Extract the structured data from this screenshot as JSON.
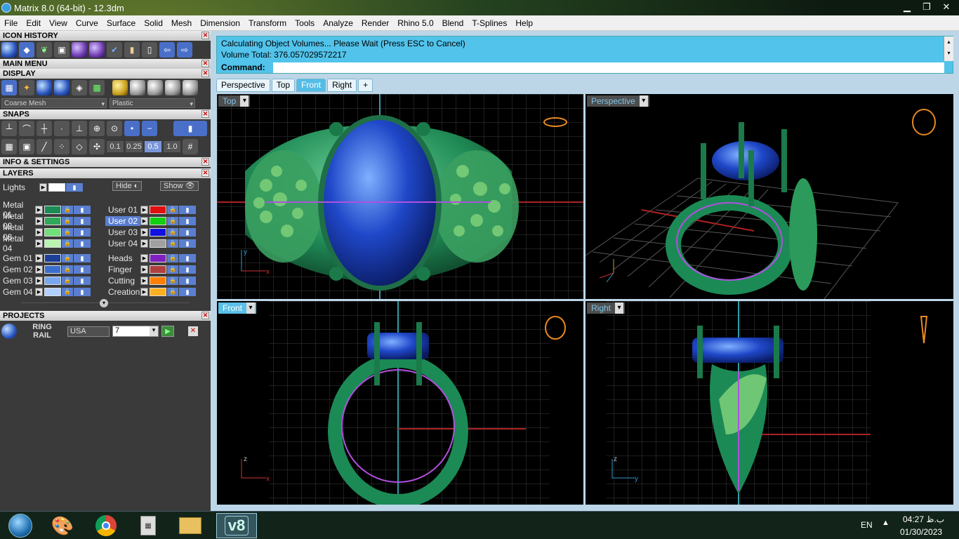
{
  "window": {
    "title": "Matrix 8.0 (64-bit) - 12.3dm",
    "buttons": {
      "minimize": "▁",
      "restore": "❐",
      "close": "✕"
    }
  },
  "menu": [
    "File",
    "Edit",
    "View",
    "Curve",
    "Surface",
    "Solid",
    "Mesh",
    "Dimension",
    "Transform",
    "Tools",
    "Analyze",
    "Render",
    "Rhino 5.0",
    "Blend",
    "T-Splines",
    "Help"
  ],
  "panel": {
    "icon_history": "ICON HISTORY",
    "main_menu": "MAIN MENU",
    "display": "DISPLAY",
    "mesh_select": "Coarse Mesh",
    "material_select": "Plastic",
    "snaps": "SNAPS",
    "snap_values": [
      "0.1",
      "0.25",
      "0.5",
      "1.0"
    ],
    "info_settings": "INFO & SETTINGS",
    "layers_title": "LAYERS",
    "lights": "Lights",
    "hide": "Hide",
    "show": "Show",
    "layers_left": [
      {
        "name": "Metal 01",
        "color": "#1a8c55"
      },
      {
        "name": "Metal 02",
        "color": "#2fa85a"
      },
      {
        "name": "Metal 03",
        "color": "#6fe07a"
      },
      {
        "name": "Metal 04",
        "color": "#b8f5b0"
      },
      {
        "name": "Gem 01",
        "color": "#1c3f9a"
      },
      {
        "name": "Gem 02",
        "color": "#3a6fd0"
      },
      {
        "name": "Gem 03",
        "color": "#7aa8f0"
      },
      {
        "name": "Gem 04",
        "color": "#b0d0ff"
      }
    ],
    "layers_right": [
      {
        "name": "User 01",
        "color": "#e01010"
      },
      {
        "name": "User 02",
        "color": "#10d010"
      },
      {
        "name": "User 03",
        "color": "#1010e0"
      },
      {
        "name": "User 04",
        "color": "#a0a0a0"
      },
      {
        "name": "Heads",
        "color": "#8020c0"
      },
      {
        "name": "Finger",
        "color": "#b04040"
      },
      {
        "name": "Cutting",
        "color": "#ff8000"
      },
      {
        "name": "Creation",
        "color": "#ffb020"
      }
    ],
    "projects": "PROJECTS",
    "project_name_1": "RING",
    "project_name_2": "RAIL",
    "region": "USA",
    "size": "7"
  },
  "command": {
    "line1": "Calculating Object Volumes... Please Wait (Press ESC to Cancel)",
    "line2": "Volume Total: 376.057029572217",
    "prompt": "Command:"
  },
  "tabs": [
    {
      "label": "Perspective",
      "active": false
    },
    {
      "label": "Top",
      "active": false
    },
    {
      "label": "Front",
      "active": true
    },
    {
      "label": "Right",
      "active": false
    },
    {
      "label": "+",
      "active": false
    }
  ],
  "viewports": {
    "top": "Top",
    "perspective": "Perspective",
    "front": "Front",
    "right": "Right"
  },
  "taskbar": {
    "language": "EN",
    "time": "04:27 ب.ظ",
    "date": "01/30/2023",
    "active_app": "v8"
  }
}
